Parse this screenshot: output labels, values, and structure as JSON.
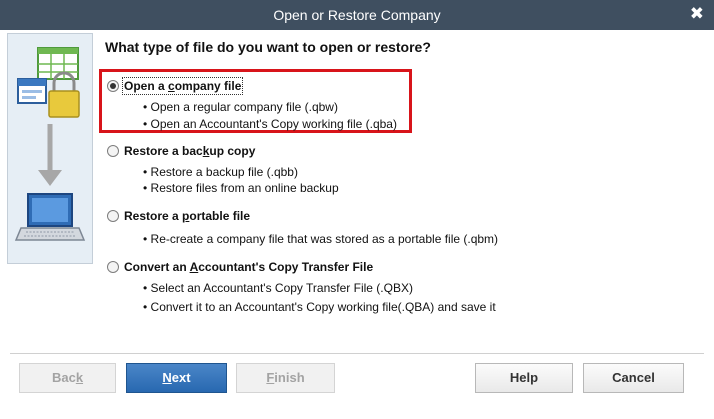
{
  "window": {
    "title": "Open or Restore Company",
    "close_glyph": "✖"
  },
  "question": "What type of file do you want to open or restore?",
  "options": [
    {
      "id": "open",
      "pre": "Open a ",
      "key": "c",
      "post": "ompany file",
      "selected": true,
      "bullets": [
        "Open a regular company file (.qbw)",
        "Open an Accountant's Copy working file (.qba)"
      ]
    },
    {
      "id": "restore-backup",
      "pre": "Restore a bac",
      "key": "k",
      "post": "up copy",
      "selected": false,
      "bullets": [
        "Restore a backup file (.qbb)",
        "Restore files from an online backup"
      ]
    },
    {
      "id": "restore-portable",
      "pre": "Restore a ",
      "key": "p",
      "post": "ortable file",
      "selected": false,
      "bullets": [
        "Re-create a company file that was stored as a portable file (.qbm)"
      ]
    },
    {
      "id": "convert",
      "pre": "Convert an ",
      "key": "A",
      "post": "ccountant's Copy Transfer File",
      "selected": false,
      "bullets": [
        "Select an Accountant's Copy Transfer File (.QBX)",
        "Convert it to an Accountant's Copy working file(.QBA) and save it"
      ]
    }
  ],
  "buttons": {
    "back": {
      "pre": "Bac",
      "key": "k",
      "post": ""
    },
    "next": {
      "pre": "",
      "key": "N",
      "post": "ext"
    },
    "finish": {
      "pre": "",
      "key": "F",
      "post": "inish"
    },
    "help": "Help",
    "cancel": "Cancel"
  },
  "colors": {
    "titlebar": "#3f4f60",
    "highlight_border": "#d8141a",
    "primary_button": "#2e6db4"
  },
  "icons": [
    "file-grid-icon",
    "lock-icon",
    "arrow-down-icon",
    "laptop-icon",
    "close-icon"
  ]
}
